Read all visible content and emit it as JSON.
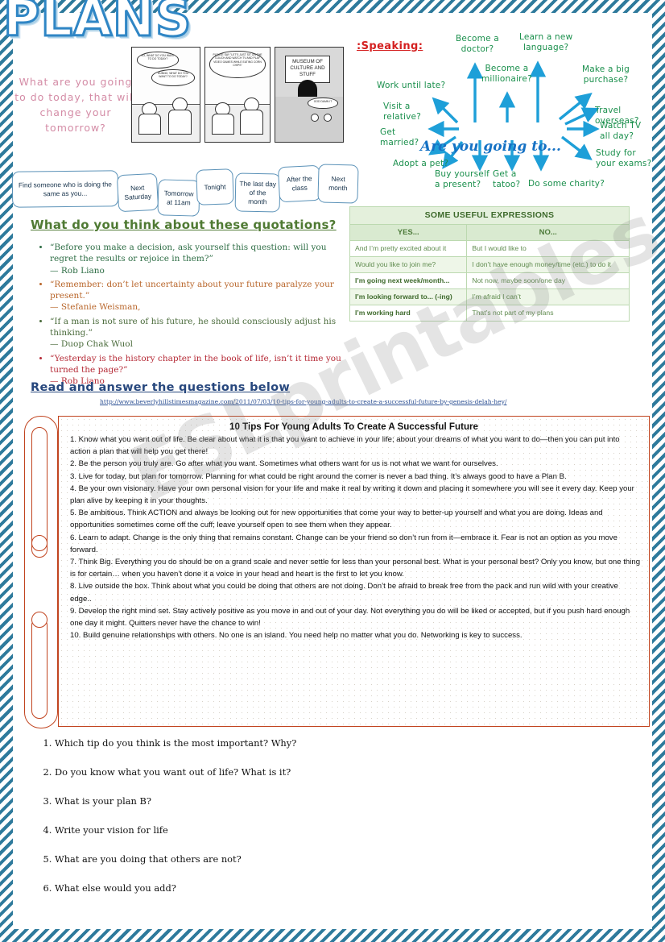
{
  "page": {
    "title": "PLANS",
    "watermark": "ESLprintables.com",
    "border_color": "#2e7a9c",
    "title_color": "#2f86c5"
  },
  "handwriting": {
    "text": "What are you going to do  today, that will change your tomorrow?",
    "color": "#d48ca6"
  },
  "comic": {
    "panels": [
      {
        "bubbles": [
          "SO, WHAT DO YOU WANT TO DO TODAY?",
          "DUNNO, WHAT DO YOU WANT TO DO TODAY?"
        ]
      },
      {
        "bubbles": [
          "PLEASE SAY \"LET'S JUST SIT ON THE COUCH AND WATCH TV AND PLAY VIDEO GAMES WHILE EATING CORN CHIPS\""
        ]
      },
      {
        "sign": "MUSEUM OF CULTURE AND STUFF",
        "bubbles": [
          "GOD DAMN IT"
        ]
      }
    ]
  },
  "speaking": {
    "heading": ":Speaking:",
    "heading_color": "#d42020",
    "center": "Are you going to...",
    "center_color": "#1571c4",
    "branch_color": "#1a8f4c",
    "arrow_color": "#1e9fd8",
    "branches": [
      "Become a\ndoctor?",
      "Learn a new\nlanguage?",
      "Become a\nmillionaire?",
      "Make a big\npurchase?",
      "Work until late?",
      "Travel overseas?",
      "Visit a\nrelative?",
      "Watch TV\nall day?",
      "Get\nmarried?",
      "Study for\nyour exams?",
      "Adopt a pet?",
      "Buy yourself\na present?",
      "Get a\ntatoo?",
      "Do some charity?"
    ]
  },
  "time_boxes": [
    "Find someone who is doing the same as you...",
    "Next Saturday",
    "Tomorrow at 11am",
    "Tonight",
    "The last day of the month",
    "After the class",
    "Next month"
  ],
  "quotations": {
    "heading": "What do you think about these quotations?",
    "heading_color": "#4f7a33",
    "items": [
      {
        "text": "“Before you make a decision, ask yourself this question: will you regret the results or rejoice in them?”",
        "author": "— Rob Liano",
        "color": "#2f6e46"
      },
      {
        "text": "“Remember: don’t let uncertainty about your future paralyze your present.”",
        "author": "— Stefanie Weisman,",
        "color": "#b9672c"
      },
      {
        "text": "“If a man is not sure of his future, he should consciously adjust his thinking.”",
        "author": "— Duop Chak Wuol",
        "color": "#4a6b3b"
      },
      {
        "text": "“Yesterday is the history chapter in the book of life, isn’t it time you turned the page?”",
        "author": "— Rob Liano",
        "color": "#b52a36"
      }
    ]
  },
  "read_section": {
    "heading": "Read and answer the questions below",
    "heading_color": "#27477d",
    "link": "http://www.beverlyhillstimesmagazine.com/2011/07/03/10-tips-for-young-adults-to-create-a-successful-future-by-genesis-delah-hey/"
  },
  "expressions_table": {
    "title": "SOME USEFUL EXPRESSIONS",
    "columns": [
      "YES...",
      "NO..."
    ],
    "rows": [
      {
        "yes": "And I’m pretty excited about it",
        "no": "But I would like to",
        "bold": false
      },
      {
        "yes": "Would you like to join me?",
        "no": "I don’t have enough money/time (etc.) to do it",
        "bold": false
      },
      {
        "yes": "I’m going next week/month...",
        "no": "Not now, maybe soon/one day",
        "bold": true
      },
      {
        "yes": "I’m looking forward to... (-ing)",
        "no": "I’m afraid I can’t",
        "bold": true
      },
      {
        "yes": "I’m working hard",
        "no": "That’s not part of my plans",
        "bold": true
      }
    ]
  },
  "tips": {
    "title": "10 Tips For Young Adults To Create A Successful Future",
    "border_color": "#c1441f",
    "items": [
      "1. Know what you want out of life. Be clear about what it is that you want to achieve in your life; about your dreams of what you want to do—then you can put into action a plan that will help you get there!",
      "2. Be the person you truly are. Go after what you want. Sometimes what others want for us is not what we want for ourselves.",
      "3. Live for today, but plan for tomorrow. Planning for what could be right around the corner is never a bad thing. It’s always good to have a Plan B.",
      "4. Be your own visionary. Have your own personal vision for your life and make it real by writing it down and placing it somewhere you will see it every day. Keep your plan alive by keeping it in your thoughts.",
      "5. Be ambitious. Think ACTION and always be looking out for new opportunities that come your way to better-up yourself and what you are doing. Ideas and opportunities sometimes come off the cuff; leave yourself open to see them when they appear.",
      "6. Learn to adapt. Change is the only thing that remains constant. Change can be your friend so don’t run from it—embrace it. Fear is not an option as you move forward.",
      "7. Think Big. Everything you do should be on a grand scale and never settle for less than your personal best. What is your personal best? Only you know, but one thing is for certain… when you haven’t done it a voice in your head and heart is the first to let you know.",
      "8. Live outside the box. Think about what you could be doing that others are not doing. Don’t be afraid to break free from the pack and run wild with your creative edge..",
      "9. Develop the right mind set. Stay actively positive as you move in and out of your day. Not everything you do will be liked or accepted, but if you push hard enough one day it might. Quitters never have the chance to win!",
      "10. Build genuine relationships with others. No one is an island. You need help no matter what you do. Networking is key to success."
    ]
  },
  "questions": [
    "Which tip do you think is the most important? Why?",
    "Do you know what you want out of life? What is it?",
    "What is your plan B?",
    "Write your vision for life",
    "What are you doing that others are not?",
    "What else would you add?"
  ]
}
